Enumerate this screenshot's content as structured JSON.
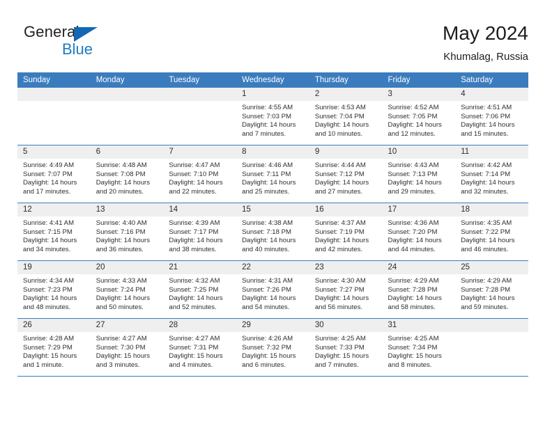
{
  "brand": {
    "name_top": "General",
    "name_bottom": "Blue",
    "triangle_color": "#1268b3",
    "blue_text_color": "#1f7ac0"
  },
  "header": {
    "title": "May 2024",
    "location": "Khumalag, Russia"
  },
  "theme": {
    "header_blue": "#3b7cbe",
    "daynum_band": "#efeff0",
    "text": "#2e2e2e"
  },
  "weekday_headers": [
    "Sunday",
    "Monday",
    "Tuesday",
    "Wednesday",
    "Thursday",
    "Friday",
    "Saturday"
  ],
  "labels": {
    "sunrise": "Sunrise:",
    "sunset": "Sunset:",
    "daylight": "Daylight:"
  },
  "weeks": [
    [
      {
        "day": "",
        "empty": true
      },
      {
        "day": "",
        "empty": true
      },
      {
        "day": "",
        "empty": true
      },
      {
        "day": "1",
        "sunrise": "Sunrise: 4:55 AM",
        "sunset": "Sunset: 7:03 PM",
        "daylight": "Daylight: 14 hours and 7 minutes."
      },
      {
        "day": "2",
        "sunrise": "Sunrise: 4:53 AM",
        "sunset": "Sunset: 7:04 PM",
        "daylight": "Daylight: 14 hours and 10 minutes."
      },
      {
        "day": "3",
        "sunrise": "Sunrise: 4:52 AM",
        "sunset": "Sunset: 7:05 PM",
        "daylight": "Daylight: 14 hours and 12 minutes."
      },
      {
        "day": "4",
        "sunrise": "Sunrise: 4:51 AM",
        "sunset": "Sunset: 7:06 PM",
        "daylight": "Daylight: 14 hours and 15 minutes."
      }
    ],
    [
      {
        "day": "5",
        "sunrise": "Sunrise: 4:49 AM",
        "sunset": "Sunset: 7:07 PM",
        "daylight": "Daylight: 14 hours and 17 minutes."
      },
      {
        "day": "6",
        "sunrise": "Sunrise: 4:48 AM",
        "sunset": "Sunset: 7:08 PM",
        "daylight": "Daylight: 14 hours and 20 minutes."
      },
      {
        "day": "7",
        "sunrise": "Sunrise: 4:47 AM",
        "sunset": "Sunset: 7:10 PM",
        "daylight": "Daylight: 14 hours and 22 minutes."
      },
      {
        "day": "8",
        "sunrise": "Sunrise: 4:46 AM",
        "sunset": "Sunset: 7:11 PM",
        "daylight": "Daylight: 14 hours and 25 minutes."
      },
      {
        "day": "9",
        "sunrise": "Sunrise: 4:44 AM",
        "sunset": "Sunset: 7:12 PM",
        "daylight": "Daylight: 14 hours and 27 minutes."
      },
      {
        "day": "10",
        "sunrise": "Sunrise: 4:43 AM",
        "sunset": "Sunset: 7:13 PM",
        "daylight": "Daylight: 14 hours and 29 minutes."
      },
      {
        "day": "11",
        "sunrise": "Sunrise: 4:42 AM",
        "sunset": "Sunset: 7:14 PM",
        "daylight": "Daylight: 14 hours and 32 minutes."
      }
    ],
    [
      {
        "day": "12",
        "sunrise": "Sunrise: 4:41 AM",
        "sunset": "Sunset: 7:15 PM",
        "daylight": "Daylight: 14 hours and 34 minutes."
      },
      {
        "day": "13",
        "sunrise": "Sunrise: 4:40 AM",
        "sunset": "Sunset: 7:16 PM",
        "daylight": "Daylight: 14 hours and 36 minutes."
      },
      {
        "day": "14",
        "sunrise": "Sunrise: 4:39 AM",
        "sunset": "Sunset: 7:17 PM",
        "daylight": "Daylight: 14 hours and 38 minutes."
      },
      {
        "day": "15",
        "sunrise": "Sunrise: 4:38 AM",
        "sunset": "Sunset: 7:18 PM",
        "daylight": "Daylight: 14 hours and 40 minutes."
      },
      {
        "day": "16",
        "sunrise": "Sunrise: 4:37 AM",
        "sunset": "Sunset: 7:19 PM",
        "daylight": "Daylight: 14 hours and 42 minutes."
      },
      {
        "day": "17",
        "sunrise": "Sunrise: 4:36 AM",
        "sunset": "Sunset: 7:20 PM",
        "daylight": "Daylight: 14 hours and 44 minutes."
      },
      {
        "day": "18",
        "sunrise": "Sunrise: 4:35 AM",
        "sunset": "Sunset: 7:22 PM",
        "daylight": "Daylight: 14 hours and 46 minutes."
      }
    ],
    [
      {
        "day": "19",
        "sunrise": "Sunrise: 4:34 AM",
        "sunset": "Sunset: 7:23 PM",
        "daylight": "Daylight: 14 hours and 48 minutes."
      },
      {
        "day": "20",
        "sunrise": "Sunrise: 4:33 AM",
        "sunset": "Sunset: 7:24 PM",
        "daylight": "Daylight: 14 hours and 50 minutes."
      },
      {
        "day": "21",
        "sunrise": "Sunrise: 4:32 AM",
        "sunset": "Sunset: 7:25 PM",
        "daylight": "Daylight: 14 hours and 52 minutes."
      },
      {
        "day": "22",
        "sunrise": "Sunrise: 4:31 AM",
        "sunset": "Sunset: 7:26 PM",
        "daylight": "Daylight: 14 hours and 54 minutes."
      },
      {
        "day": "23",
        "sunrise": "Sunrise: 4:30 AM",
        "sunset": "Sunset: 7:27 PM",
        "daylight": "Daylight: 14 hours and 56 minutes."
      },
      {
        "day": "24",
        "sunrise": "Sunrise: 4:29 AM",
        "sunset": "Sunset: 7:28 PM",
        "daylight": "Daylight: 14 hours and 58 minutes."
      },
      {
        "day": "25",
        "sunrise": "Sunrise: 4:29 AM",
        "sunset": "Sunset: 7:28 PM",
        "daylight": "Daylight: 14 hours and 59 minutes."
      }
    ],
    [
      {
        "day": "26",
        "sunrise": "Sunrise: 4:28 AM",
        "sunset": "Sunset: 7:29 PM",
        "daylight": "Daylight: 15 hours and 1 minute."
      },
      {
        "day": "27",
        "sunrise": "Sunrise: 4:27 AM",
        "sunset": "Sunset: 7:30 PM",
        "daylight": "Daylight: 15 hours and 3 minutes."
      },
      {
        "day": "28",
        "sunrise": "Sunrise: 4:27 AM",
        "sunset": "Sunset: 7:31 PM",
        "daylight": "Daylight: 15 hours and 4 minutes."
      },
      {
        "day": "29",
        "sunrise": "Sunrise: 4:26 AM",
        "sunset": "Sunset: 7:32 PM",
        "daylight": "Daylight: 15 hours and 6 minutes."
      },
      {
        "day": "30",
        "sunrise": "Sunrise: 4:25 AM",
        "sunset": "Sunset: 7:33 PM",
        "daylight": "Daylight: 15 hours and 7 minutes."
      },
      {
        "day": "31",
        "sunrise": "Sunrise: 4:25 AM",
        "sunset": "Sunset: 7:34 PM",
        "daylight": "Daylight: 15 hours and 8 minutes."
      },
      {
        "day": "",
        "empty": true
      }
    ]
  ]
}
